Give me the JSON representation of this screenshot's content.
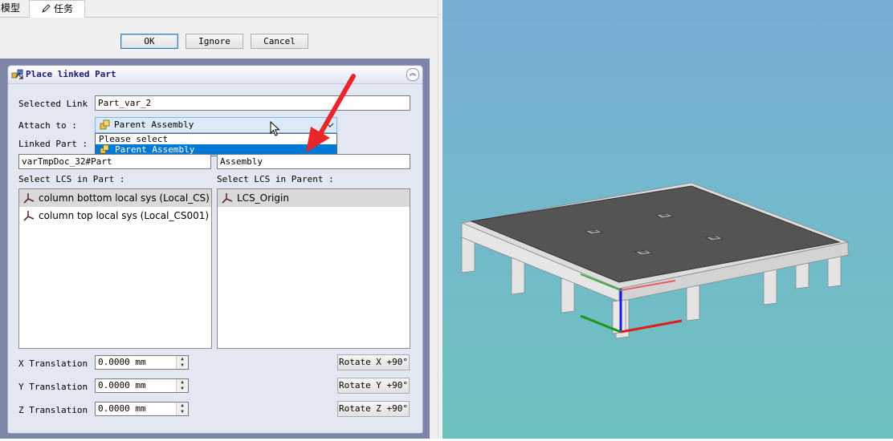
{
  "tabs": {
    "model": "模型",
    "task": "任务"
  },
  "actions": {
    "ok": "OK",
    "ignore": "Ignore",
    "cancel": "Cancel"
  },
  "panel": {
    "title": "Place linked Part",
    "selected_link_label": "Selected Link :",
    "selected_link_value": "Part_var_2",
    "attach_to_label": "Attach to :",
    "attach_to_value": "Parent Assembly",
    "dropdown_options": [
      "Please select",
      "Parent Assembly"
    ],
    "linked_part_label": "Linked Part :",
    "linked_part_value": "varTmpDoc_32#Part",
    "parent_value": "Assembly",
    "lcs_part_label": "Select LCS in Part :",
    "lcs_parent_label": "Select LCS in Parent :",
    "lcs_part_items": [
      "column bottom local sys (Local_CS)",
      "column top local sys (Local_CS001)"
    ],
    "lcs_parent_items": [
      "LCS_Origin"
    ],
    "x_label": "X Translation :",
    "y_label": "Y Translation :",
    "z_label": "Z Translation :",
    "x_value": "0.0000 mm",
    "y_value": "0.0000 mm",
    "z_value": "0.0000 mm",
    "rotate_x": "Rotate X +90°",
    "rotate_y": "Rotate Y +90°",
    "rotate_z": "Rotate Z +90°"
  },
  "colors": {
    "accent": "#0078d7",
    "annotation_arrow": "#e8262b",
    "axis_x": "#e01e1e",
    "axis_y": "#1a9a1a",
    "axis_z": "#1a1ae0"
  }
}
